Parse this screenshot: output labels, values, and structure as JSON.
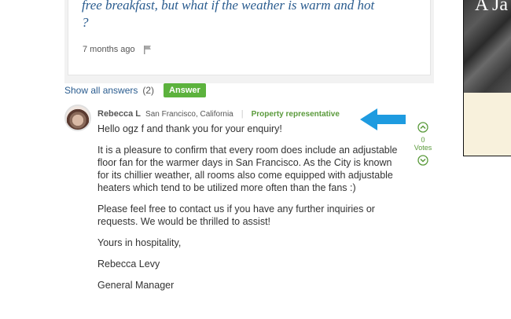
{
  "question": {
    "text_line1": "free breakfast, but what if the weather is warm and hot",
    "text_line2": "?",
    "time_ago": "7 months ago"
  },
  "answers_bar": {
    "show_all_label": "Show all answers",
    "count": "(2)",
    "answer_button_label": "Answer"
  },
  "answer": {
    "author_name": "Rebecca L",
    "author_location": "San Francisco, California",
    "separator": "|",
    "badge": "Property representative",
    "paragraphs": [
      "Hello ogz f and thank you for your enquiry!",
      "It is a pleasure to confirm that every room does include an adjustable floor fan for the warmer days in San Francisco. As the City is known for its chillier weather, all rooms also come equipped with adjustable heaters which tend to be utilized more often than the fans :)",
      "Please feel free to contact us if you have any further inquiries or requests. We would be thrilled to assist!",
      "Yours in hospitality,",
      "Rebecca Levy",
      "General Manager"
    ],
    "votes_count": "0",
    "votes_label": "Votes"
  },
  "sidebar": {
    "title_fragment": "A Ja"
  },
  "colors": {
    "link_blue": "#2a5c8f",
    "accent_green": "#5cb23d",
    "arrow_blue": "#1e9be0",
    "panel_cream": "#f8f1dc"
  },
  "icons": [
    "flag-icon",
    "arrow-annotation-icon",
    "vote-up-icon",
    "vote-down-icon"
  ]
}
